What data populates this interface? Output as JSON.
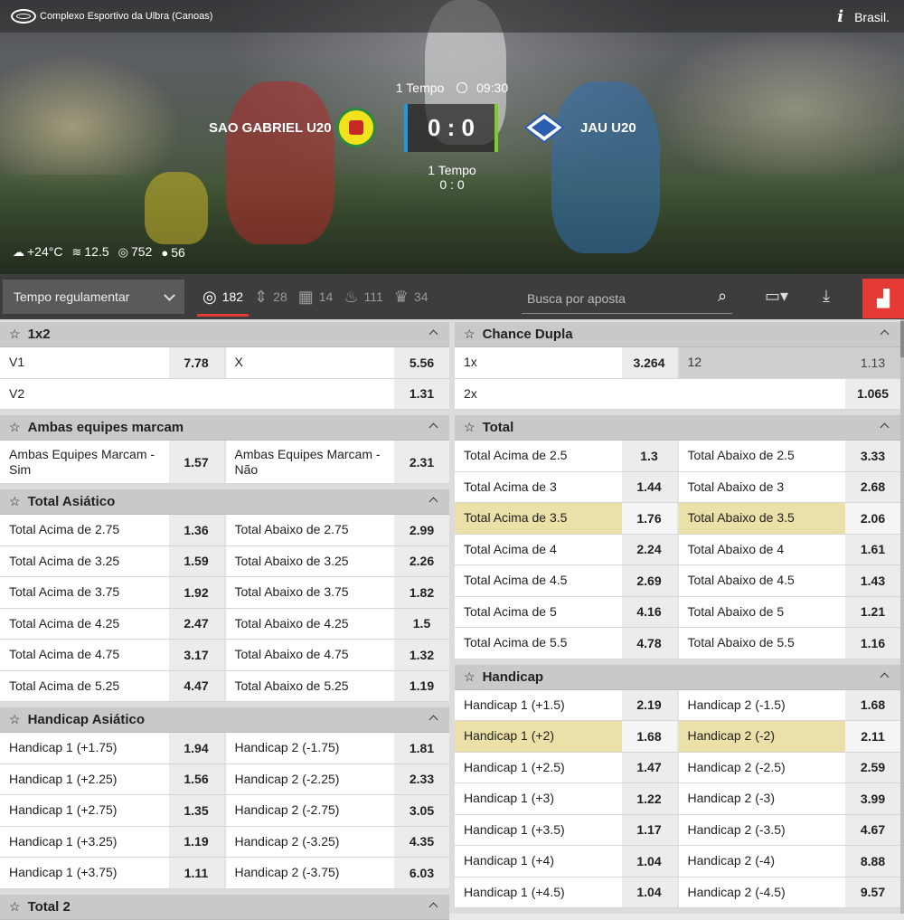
{
  "header": {
    "venue": "Complexo Esportivo da Ulbra (Canoas)",
    "region": "Brasil."
  },
  "match": {
    "period": "1 Tempo",
    "time": "09:30",
    "home": "SAO GABRIEL U20",
    "away": "JAU U20",
    "score": "0 : 0",
    "sub_period": "1 Tempo",
    "sub_score": "0 : 0"
  },
  "weather": {
    "temp": "+24°C",
    "wind": "12.5",
    "pressure": "752",
    "humidity": "56"
  },
  "toolbar": {
    "period_select": "Tempo regulamentar",
    "counts": [
      "182",
      "28",
      "14",
      "111",
      "34"
    ],
    "search_placeholder": "Busca por aposta"
  },
  "left": [
    {
      "title": "1x2",
      "rows": [
        [
          {
            "l": "V1",
            "o": "7.78"
          },
          {
            "l": "X",
            "o": "5.56"
          }
        ],
        [
          {
            "l": "V2",
            "o": "1.31"
          }
        ]
      ]
    },
    {
      "title": "Ambas equipes marcam",
      "rows": [
        [
          {
            "l": "Ambas Equipes Marcam - Sim",
            "o": "1.57"
          },
          {
            "l": "Ambas Equipes Marcam - Não",
            "o": "2.31"
          }
        ]
      ]
    },
    {
      "title": "Total Asiático",
      "rows": [
        [
          {
            "l": "Total Acima de 2.75",
            "o": "1.36"
          },
          {
            "l": "Total Abaixo de 2.75",
            "o": "2.99"
          }
        ],
        [
          {
            "l": "Total Acima de 3.25",
            "o": "1.59"
          },
          {
            "l": "Total Abaixo de 3.25",
            "o": "2.26"
          }
        ],
        [
          {
            "l": "Total Acima de 3.75",
            "o": "1.92"
          },
          {
            "l": "Total Abaixo de 3.75",
            "o": "1.82"
          }
        ],
        [
          {
            "l": "Total Acima de 4.25",
            "o": "2.47"
          },
          {
            "l": "Total Abaixo de 4.25",
            "o": "1.5"
          }
        ],
        [
          {
            "l": "Total Acima de 4.75",
            "o": "3.17"
          },
          {
            "l": "Total Abaixo de 4.75",
            "o": "1.32"
          }
        ],
        [
          {
            "l": "Total Acima de 5.25",
            "o": "4.47"
          },
          {
            "l": "Total Abaixo de 5.25",
            "o": "1.19"
          }
        ]
      ]
    },
    {
      "title": "Handicap Asiático",
      "rows": [
        [
          {
            "l": "Handicap 1 (+1.75)",
            "o": "1.94"
          },
          {
            "l": "Handicap 2 (-1.75)",
            "o": "1.81"
          }
        ],
        [
          {
            "l": "Handicap 1 (+2.25)",
            "o": "1.56"
          },
          {
            "l": "Handicap 2 (-2.25)",
            "o": "2.33"
          }
        ],
        [
          {
            "l": "Handicap 1 (+2.75)",
            "o": "1.35"
          },
          {
            "l": "Handicap 2 (-2.75)",
            "o": "3.05"
          }
        ],
        [
          {
            "l": "Handicap 1 (+3.25)",
            "o": "1.19"
          },
          {
            "l": "Handicap 2 (-3.25)",
            "o": "4.35"
          }
        ],
        [
          {
            "l": "Handicap 1 (+3.75)",
            "o": "1.11"
          },
          {
            "l": "Handicap 2 (-3.75)",
            "o": "6.03"
          }
        ]
      ]
    },
    {
      "title": "Total 2",
      "rows": []
    }
  ],
  "right": [
    {
      "title": "Chance Dupla",
      "rows": [
        [
          {
            "l": "1x",
            "o": "3.264"
          },
          {
            "l": "12",
            "o": "1.13",
            "dim": true
          }
        ],
        [
          {
            "l": "2x",
            "o": "1.065"
          }
        ]
      ]
    },
    {
      "title": "Total",
      "rows": [
        [
          {
            "l": "Total Acima de 2.5",
            "o": "1.3"
          },
          {
            "l": "Total Abaixo de 2.5",
            "o": "3.33"
          }
        ],
        [
          {
            "l": "Total Acima de 3",
            "o": "1.44"
          },
          {
            "l": "Total Abaixo de 3",
            "o": "2.68"
          }
        ],
        [
          {
            "l": "Total Acima de 3.5",
            "o": "1.76",
            "hl": true
          },
          {
            "l": "Total Abaixo de 3.5",
            "o": "2.06",
            "hl": true
          }
        ],
        [
          {
            "l": "Total Acima de 4",
            "o": "2.24"
          },
          {
            "l": "Total Abaixo de 4",
            "o": "1.61"
          }
        ],
        [
          {
            "l": "Total Acima de 4.5",
            "o": "2.69"
          },
          {
            "l": "Total Abaixo de 4.5",
            "o": "1.43"
          }
        ],
        [
          {
            "l": "Total Acima de 5",
            "o": "4.16"
          },
          {
            "l": "Total Abaixo de 5",
            "o": "1.21"
          }
        ],
        [
          {
            "l": "Total Acima de 5.5",
            "o": "4.78"
          },
          {
            "l": "Total Abaixo de 5.5",
            "o": "1.16"
          }
        ]
      ]
    },
    {
      "title": "Handicap",
      "rows": [
        [
          {
            "l": "Handicap 1 (+1.5)",
            "o": "2.19"
          },
          {
            "l": "Handicap 2 (-1.5)",
            "o": "1.68"
          }
        ],
        [
          {
            "l": "Handicap 1 (+2)",
            "o": "1.68",
            "hl": true
          },
          {
            "l": "Handicap 2 (-2)",
            "o": "2.11",
            "hl": true
          }
        ],
        [
          {
            "l": "Handicap 1 (+2.5)",
            "o": "1.47"
          },
          {
            "l": "Handicap 2 (-2.5)",
            "o": "2.59"
          }
        ],
        [
          {
            "l": "Handicap 1 (+3)",
            "o": "1.22"
          },
          {
            "l": "Handicap 2 (-3)",
            "o": "3.99"
          }
        ],
        [
          {
            "l": "Handicap 1 (+3.5)",
            "o": "1.17"
          },
          {
            "l": "Handicap 2 (-3.5)",
            "o": "4.67"
          }
        ],
        [
          {
            "l": "Handicap 1 (+4)",
            "o": "1.04"
          },
          {
            "l": "Handicap 2 (-4)",
            "o": "8.88"
          }
        ],
        [
          {
            "l": "Handicap 1 (+4.5)",
            "o": "1.04"
          },
          {
            "l": "Handicap 2 (-4.5)",
            "o": "9.57"
          }
        ]
      ]
    }
  ]
}
